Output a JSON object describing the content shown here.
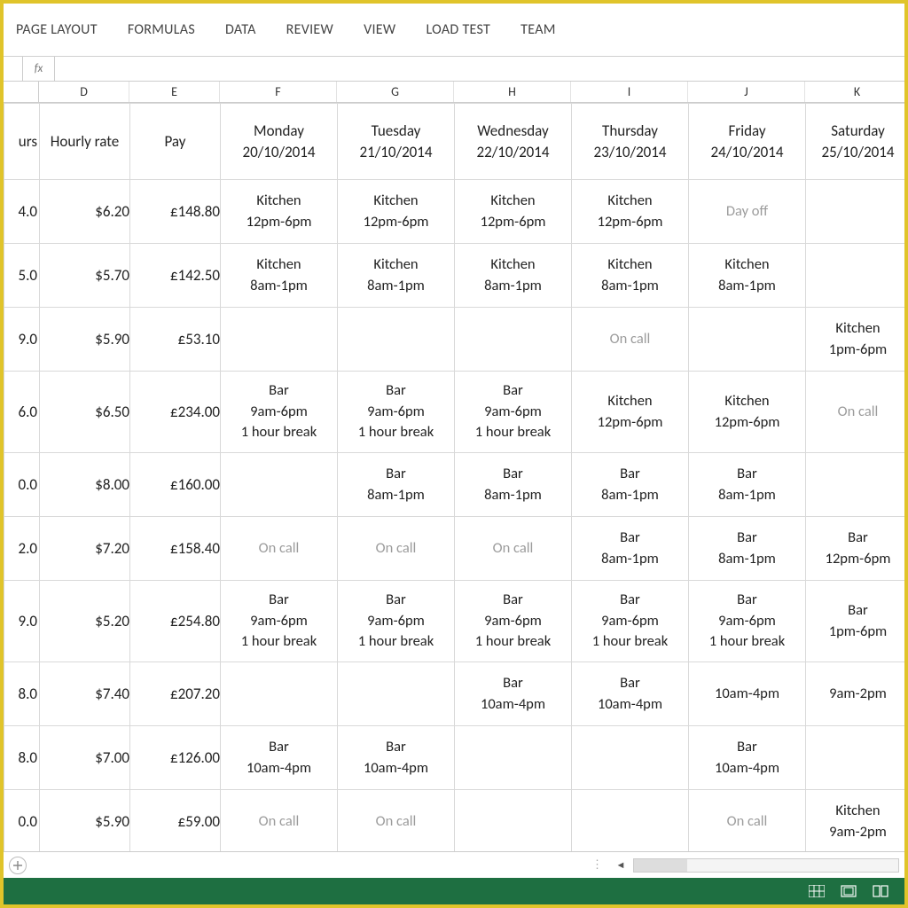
{
  "ribbon": {
    "tabs": [
      "PAGE LAYOUT",
      "FORMULAS",
      "DATA",
      "REVIEW",
      "VIEW",
      "LOAD TEST",
      "TEAM"
    ]
  },
  "fx": {
    "label": "fx"
  },
  "columns": [
    "",
    "D",
    "E",
    "F",
    "G",
    "H",
    "I",
    "J",
    "K"
  ],
  "headers": {
    "hours": "urs",
    "rate": "Hourly rate",
    "pay": "Pay",
    "days": [
      {
        "name": "Monday",
        "date": "20/10/2014"
      },
      {
        "name": "Tuesday",
        "date": "21/10/2014"
      },
      {
        "name": "Wednesday",
        "date": "22/10/2014"
      },
      {
        "name": "Thursday",
        "date": "23/10/2014"
      },
      {
        "name": "Friday",
        "date": "24/10/2014"
      },
      {
        "name": "Saturday",
        "date": "25/10/2014"
      }
    ]
  },
  "rows": [
    {
      "hours": "4.0",
      "rate": "$6.20",
      "pay": "£148.80",
      "h": "h2",
      "cells": [
        {
          "lines": [
            "Kitchen",
            "12pm-6pm"
          ]
        },
        {
          "lines": [
            "Kitchen",
            "12pm-6pm"
          ]
        },
        {
          "lines": [
            "Kitchen",
            "12pm-6pm"
          ]
        },
        {
          "lines": [
            "Kitchen",
            "12pm-6pm"
          ]
        },
        {
          "lines": [
            "Day off"
          ],
          "muted": true
        },
        {
          "lines": []
        }
      ]
    },
    {
      "hours": "5.0",
      "rate": "$5.70",
      "pay": "£142.50",
      "h": "h2",
      "cells": [
        {
          "lines": [
            "Kitchen",
            "8am-1pm"
          ]
        },
        {
          "lines": [
            "Kitchen",
            "8am-1pm"
          ]
        },
        {
          "lines": [
            "Kitchen",
            "8am-1pm"
          ]
        },
        {
          "lines": [
            "Kitchen",
            "8am-1pm"
          ]
        },
        {
          "lines": [
            "Kitchen",
            "8am-1pm"
          ]
        },
        {
          "lines": []
        }
      ]
    },
    {
      "hours": "9.0",
      "rate": "$5.90",
      "pay": "£53.10",
      "h": "h2",
      "cells": [
        {
          "lines": []
        },
        {
          "lines": []
        },
        {
          "lines": []
        },
        {
          "lines": [
            "On call"
          ],
          "muted": true
        },
        {
          "lines": []
        },
        {
          "lines": [
            "Kitchen",
            "1pm-6pm"
          ]
        }
      ]
    },
    {
      "hours": "6.0",
      "rate": "$6.50",
      "pay": "£234.00",
      "h": "h3",
      "cells": [
        {
          "lines": [
            "Bar",
            "9am-6pm",
            "1 hour break"
          ]
        },
        {
          "lines": [
            "Bar",
            "9am-6pm",
            "1 hour break"
          ]
        },
        {
          "lines": [
            "Bar",
            "9am-6pm",
            "1 hour break"
          ]
        },
        {
          "lines": [
            "Kitchen",
            "12pm-6pm"
          ]
        },
        {
          "lines": [
            "Kitchen",
            "12pm-6pm"
          ]
        },
        {
          "lines": [
            "On call"
          ],
          "muted": true
        }
      ]
    },
    {
      "hours": "0.0",
      "rate": "$8.00",
      "pay": "£160.00",
      "h": "h2",
      "cells": [
        {
          "lines": []
        },
        {
          "lines": [
            "Bar",
            "8am-1pm"
          ]
        },
        {
          "lines": [
            "Bar",
            "8am-1pm"
          ]
        },
        {
          "lines": [
            "Bar",
            "8am-1pm"
          ]
        },
        {
          "lines": [
            "Bar",
            "8am-1pm"
          ]
        },
        {
          "lines": []
        }
      ]
    },
    {
      "hours": "2.0",
      "rate": "$7.20",
      "pay": "£158.40",
      "h": "h2",
      "cells": [
        {
          "lines": [
            "On call"
          ],
          "muted": true
        },
        {
          "lines": [
            "On call"
          ],
          "muted": true
        },
        {
          "lines": [
            "On call"
          ],
          "muted": true
        },
        {
          "lines": [
            "Bar",
            "8am-1pm"
          ]
        },
        {
          "lines": [
            "Bar",
            "8am-1pm"
          ]
        },
        {
          "lines": [
            "Bar",
            "12pm-6pm"
          ]
        }
      ]
    },
    {
      "hours": "9.0",
      "rate": "$5.20",
      "pay": "£254.80",
      "h": "h3",
      "cells": [
        {
          "lines": [
            "Bar",
            "9am-6pm",
            "1 hour break"
          ]
        },
        {
          "lines": [
            "Bar",
            "9am-6pm",
            "1 hour break"
          ]
        },
        {
          "lines": [
            "Bar",
            "9am-6pm",
            "1 hour break"
          ]
        },
        {
          "lines": [
            "Bar",
            "9am-6pm",
            "1 hour break"
          ]
        },
        {
          "lines": [
            "Bar",
            "9am-6pm",
            "1 hour break"
          ]
        },
        {
          "lines": [
            "Bar",
            "1pm-6pm"
          ]
        }
      ]
    },
    {
      "hours": "8.0",
      "rate": "$7.40",
      "pay": "£207.20",
      "h": "h2",
      "cells": [
        {
          "lines": []
        },
        {
          "lines": []
        },
        {
          "lines": [
            "Bar",
            "10am-4pm"
          ]
        },
        {
          "lines": [
            "Bar",
            "10am-4pm"
          ]
        },
        {
          "lines": [
            "10am-4pm"
          ]
        },
        {
          "lines": [
            "9am-2pm"
          ]
        }
      ]
    },
    {
      "hours": "8.0",
      "rate": "$7.00",
      "pay": "£126.00",
      "h": "h2",
      "cells": [
        {
          "lines": [
            "Bar",
            "10am-4pm"
          ]
        },
        {
          "lines": [
            "Bar",
            "10am-4pm"
          ]
        },
        {
          "lines": []
        },
        {
          "lines": []
        },
        {
          "lines": [
            "Bar",
            "10am-4pm"
          ]
        },
        {
          "lines": []
        }
      ]
    },
    {
      "hours": "0.0",
      "rate": "$5.90",
      "pay": "£59.00",
      "h": "h2",
      "cells": [
        {
          "lines": [
            "On call"
          ],
          "muted": true
        },
        {
          "lines": [
            "On call"
          ],
          "muted": true
        },
        {
          "lines": []
        },
        {
          "lines": []
        },
        {
          "lines": [
            "On call"
          ],
          "muted": true
        },
        {
          "lines": [
            "Kitchen",
            "9am-2pm"
          ]
        }
      ]
    }
  ],
  "statusbar": {
    "views": [
      "normal",
      "page-layout",
      "page-break"
    ]
  }
}
